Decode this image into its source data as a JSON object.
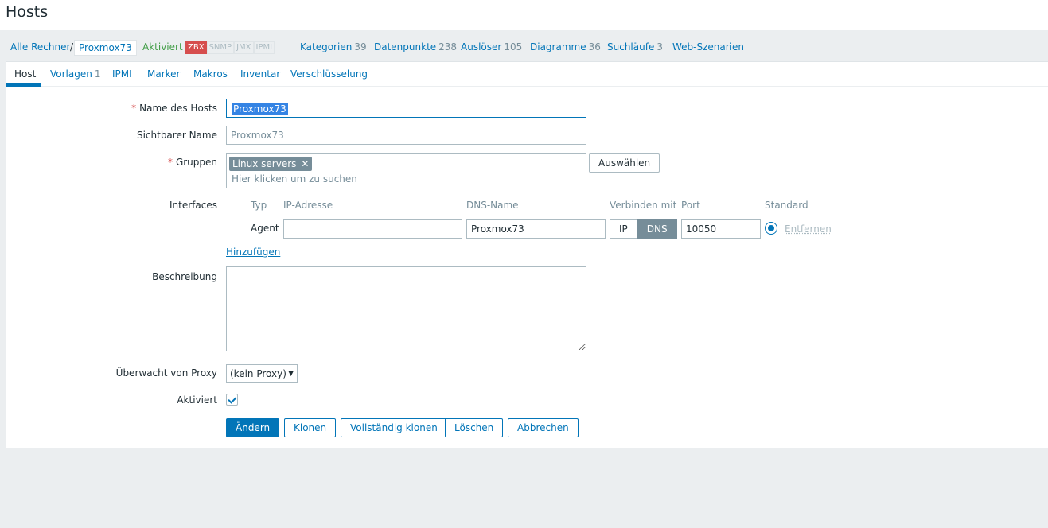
{
  "page": {
    "title": "Hosts"
  },
  "nav": {
    "all_hosts": "Alle Rechner",
    "separator": "/",
    "host_name": "Proxmox73",
    "status": "Aktiviert",
    "availability": [
      "ZBX",
      "SNMP",
      "JMX",
      "IPMI"
    ],
    "applications": {
      "label": "Kategorien",
      "count": "39"
    },
    "items": {
      "label": "Datenpunkte",
      "count": "238"
    },
    "triggers": {
      "label": "Auslöser",
      "count": "105"
    },
    "graphs": {
      "label": "Diagramme",
      "count": "36"
    },
    "discovery": {
      "label": "Suchläufe",
      "count": "3"
    },
    "web": {
      "label": "Web-Szenarien"
    }
  },
  "tabs": {
    "host": "Host",
    "templates": {
      "label": "Vorlagen",
      "count": "1"
    },
    "ipmi": "IPMI",
    "tags": "Marker",
    "macros": "Makros",
    "inventory": "Inventar",
    "encryption": "Verschlüsselung"
  },
  "form": {
    "host_name": {
      "label": "Name des Hosts",
      "value": "Proxmox73"
    },
    "visible_name": {
      "label": "Sichtbarer Name",
      "placeholder": "Proxmox73"
    },
    "groups": {
      "label": "Gruppen",
      "chip": "Linux servers",
      "placeholder": "Hier klicken um zu suchen",
      "select_button": "Auswählen"
    },
    "interfaces": {
      "label": "Interfaces",
      "headers": {
        "type": "Typ",
        "ip": "IP-Adresse",
        "dns": "DNS-Name",
        "connect": "Verbinden mit",
        "port": "Port",
        "default": "Standard"
      },
      "row": {
        "type": "Agent",
        "ip": "",
        "dns": "Proxmox73",
        "connect_ip": "IP",
        "connect_dns": "DNS",
        "port": "10050",
        "remove": "Entfernen"
      },
      "add": "Hinzufügen"
    },
    "description": {
      "label": "Beschreibung",
      "value": ""
    },
    "proxy": {
      "label": "Überwacht von Proxy",
      "value": "(kein Proxy)"
    },
    "enabled": {
      "label": "Aktiviert"
    },
    "buttons": {
      "update": "Ändern",
      "clone": "Klonen",
      "full_clone": "Vollständig klonen",
      "delete": "Löschen",
      "cancel": "Abbrechen"
    }
  },
  "colors": {
    "accent": "#0275b8",
    "enabled": "#429e47",
    "required": "#d64e4e",
    "zbx_error": "#d64e4e"
  }
}
